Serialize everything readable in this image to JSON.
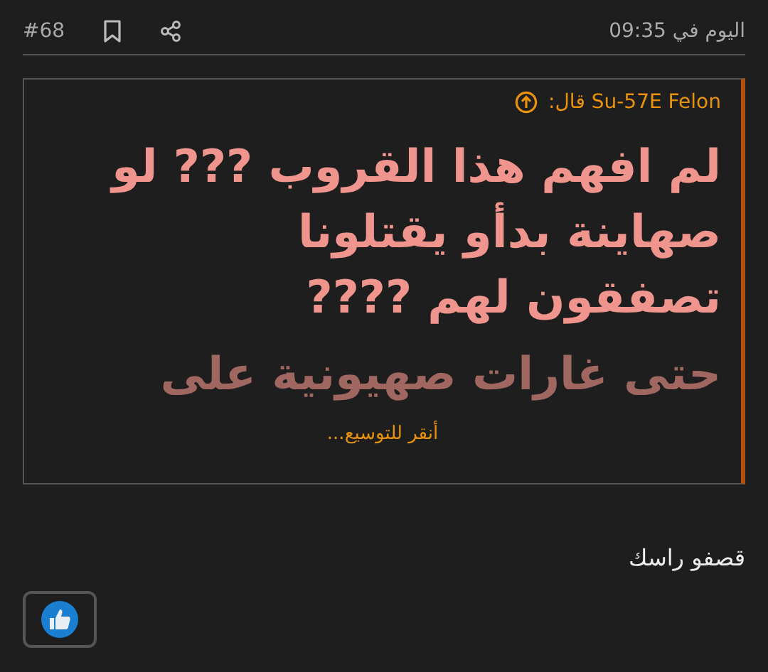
{
  "post": {
    "number": "#68",
    "time": "اليوم في 09:35"
  },
  "quote": {
    "author": "Su-57E Felon قال:",
    "lines": [
      "لم افهم هذا القروب ??? لو",
      "صهاينة بدأو يقتلونا",
      "تصفقون لهم ????",
      "حتى غارات صهيونية على"
    ],
    "truncated": true,
    "expand": "أنقر للتوسيع..."
  },
  "body": "قصفو راسك",
  "reaction": {
    "selected": false
  }
}
